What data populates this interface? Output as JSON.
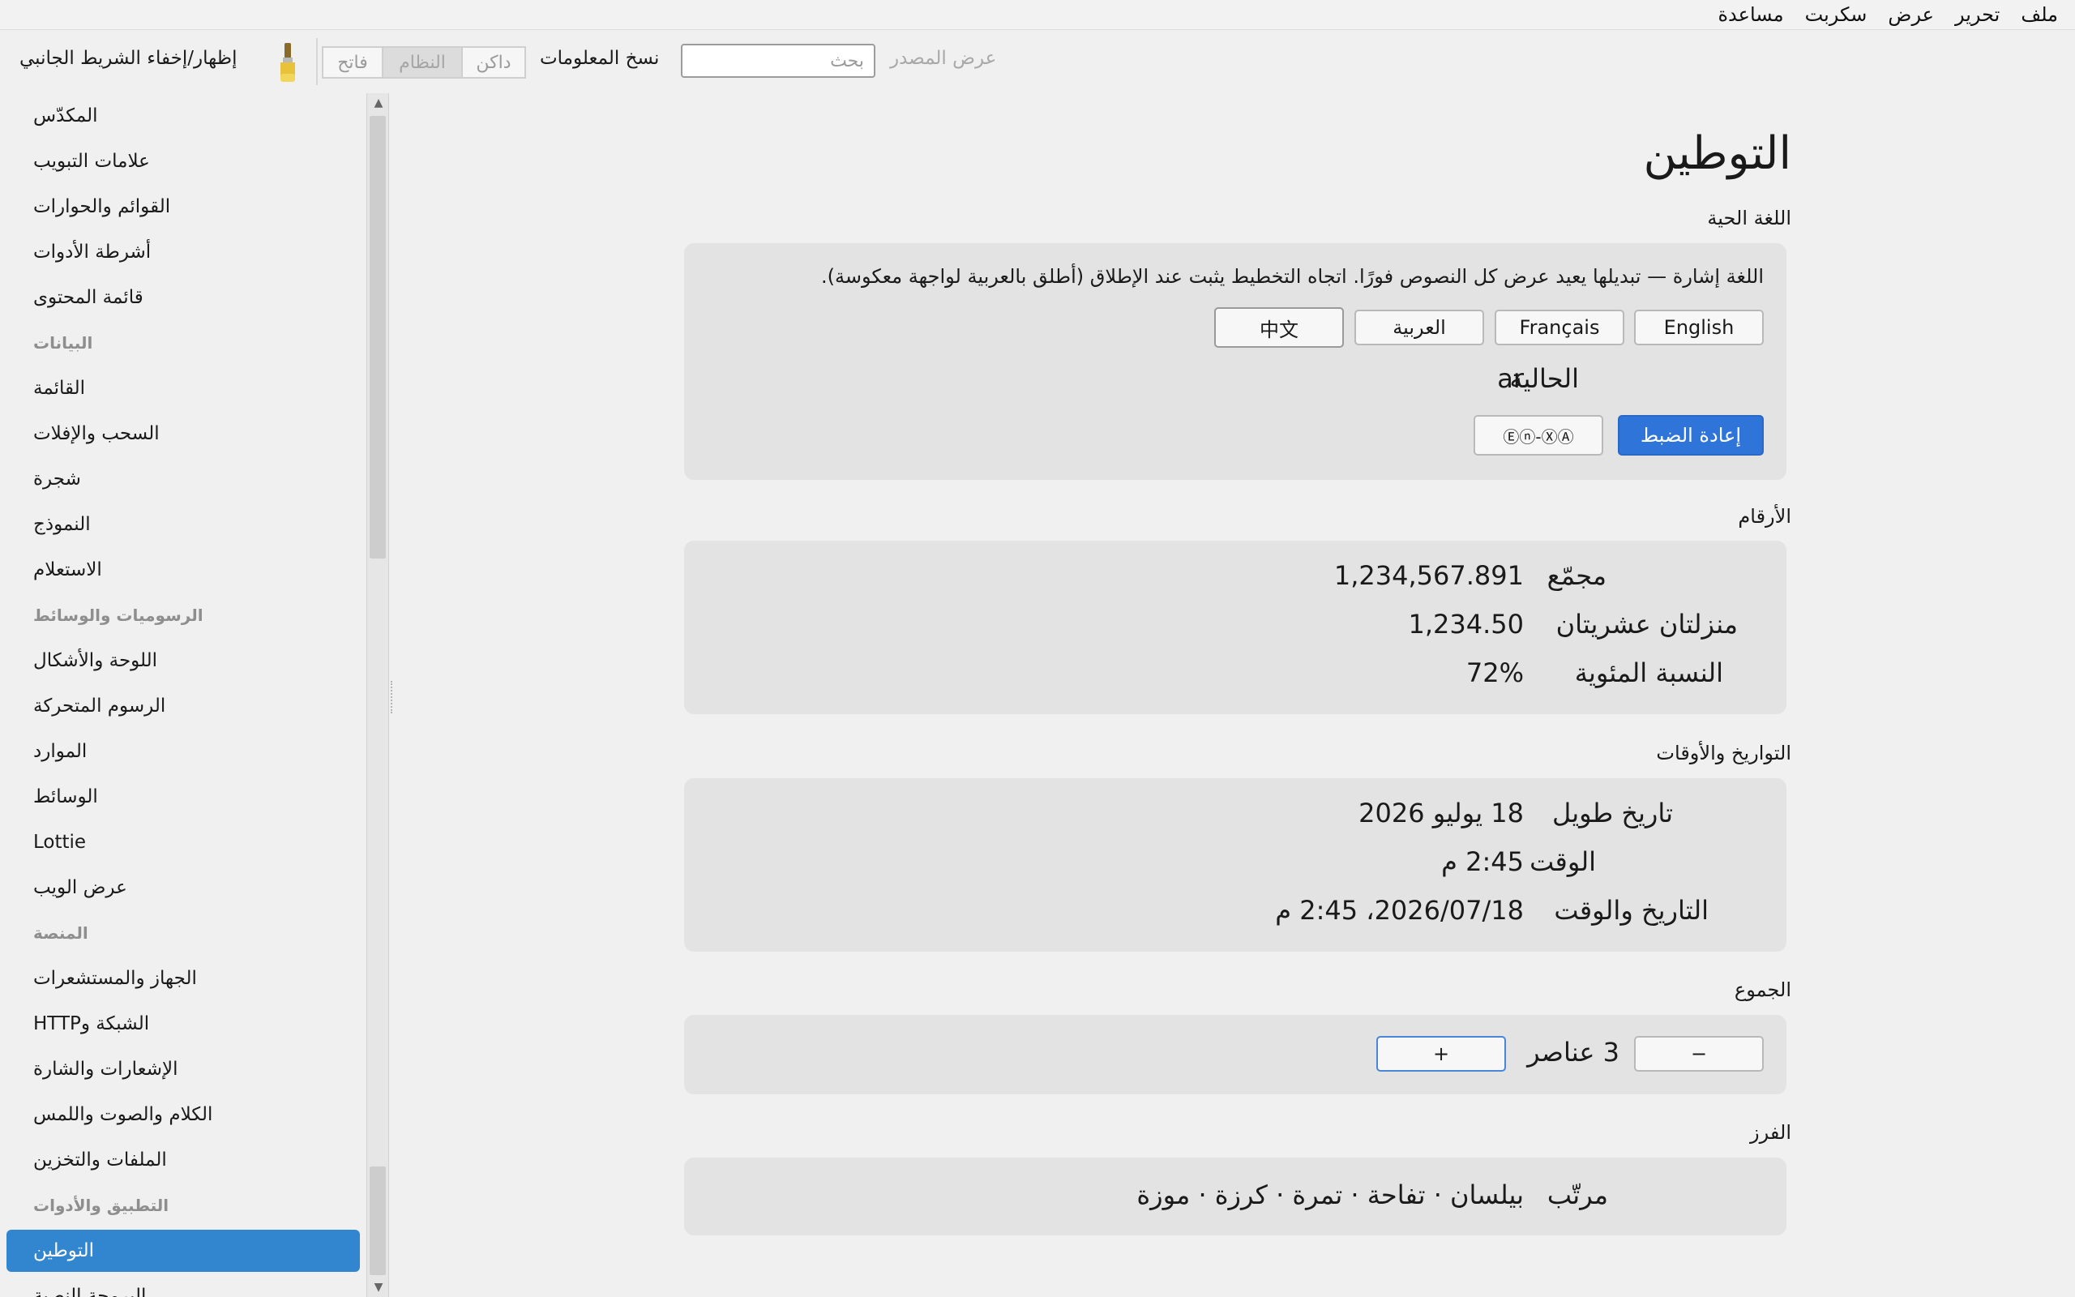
{
  "menu": [
    "ملف",
    "تحرير",
    "عرض",
    "سكربت",
    "مساعدة"
  ],
  "toolbar": {
    "sidebar_toggle": "إظهار/إخفاء الشريط الجانبي",
    "appearance": {
      "light": "فاتح",
      "system": "النظام",
      "dark": "داكن",
      "active": "system"
    },
    "copy_info": "نسخ المعلومات",
    "search_placeholder": "بحث",
    "view_source": "عرض المصدر"
  },
  "sidebar": {
    "items": [
      {
        "type": "item",
        "label": "المكدّس"
      },
      {
        "type": "item",
        "label": "علامات التبويب"
      },
      {
        "type": "item",
        "label": "القوائم والحوارات"
      },
      {
        "type": "item",
        "label": "أشرطة الأدوات"
      },
      {
        "type": "item",
        "label": "قائمة المحتوى"
      },
      {
        "type": "header",
        "label": "البيانات"
      },
      {
        "type": "item",
        "label": "القائمة"
      },
      {
        "type": "item",
        "label": "السحب والإفلات"
      },
      {
        "type": "item",
        "label": "شجرة"
      },
      {
        "type": "item",
        "label": "النموذج"
      },
      {
        "type": "item",
        "label": "الاستعلام"
      },
      {
        "type": "header",
        "label": "الرسوميات والوسائط"
      },
      {
        "type": "item",
        "label": "اللوحة والأشكال"
      },
      {
        "type": "item",
        "label": "الرسوم المتحركة"
      },
      {
        "type": "item",
        "label": "الموارد"
      },
      {
        "type": "item",
        "label": "الوسائط"
      },
      {
        "type": "item",
        "label": "Lottie"
      },
      {
        "type": "item",
        "label": "عرض الويب"
      },
      {
        "type": "header",
        "label": "المنصة"
      },
      {
        "type": "item",
        "label": "الجهاز والمستشعرات"
      },
      {
        "type": "item",
        "label": "الشبكة وHTTP"
      },
      {
        "type": "item",
        "label": "الإشعارات والشارة"
      },
      {
        "type": "item",
        "label": "الكلام والصوت واللمس"
      },
      {
        "type": "item",
        "label": "الملفات والتخزين"
      },
      {
        "type": "header",
        "label": "التطبيق والأدوات"
      },
      {
        "type": "item",
        "label": "التوطين",
        "active": true
      },
      {
        "type": "item",
        "label": "البرمجة النصية"
      }
    ]
  },
  "page": {
    "title": "التوطين",
    "live_language": {
      "title": "اللغة الحية",
      "note": "اللغة إشارة — تبديلها يعيد عرض كل النصوص فورًا. اتجاه التخطيط يثبت عند الإطلاق (أطلق بالعربية لواجهة معكوسة).",
      "languages": [
        "English",
        "Français",
        "العربية",
        "中文"
      ],
      "current_label": "الحالية",
      "current_value": "ar",
      "reset_label": "إعادة الضبط",
      "pseudo_label": "Ⓔⓝ-ⓍⒶ"
    },
    "numbers": {
      "title": "الأرقام",
      "rows": [
        {
          "label": "مجمّع",
          "value": "1,234,567.891"
        },
        {
          "label": "منزلتان عشريتان",
          "value": "1,234.50"
        },
        {
          "label": "النسبة المئوية",
          "value": "72%"
        }
      ]
    },
    "dates": {
      "title": "التواريخ والأوقات",
      "rows": [
        {
          "label": "تاريخ طويل",
          "value": "18 يوليو 2026"
        },
        {
          "label": "الوقت",
          "value": "2:45 م"
        },
        {
          "label": "التاريخ والوقت",
          "value": "2026/07/18، 2:45 م"
        }
      ]
    },
    "plurals": {
      "title": "الجموع",
      "decrement": "−",
      "count_text": "3 عناصر",
      "increment": "+"
    },
    "sorting": {
      "title": "الفرز",
      "label": "مرتّب",
      "value": "بيلسان · تفاحة · تمرة · كرزة · موزة"
    }
  }
}
